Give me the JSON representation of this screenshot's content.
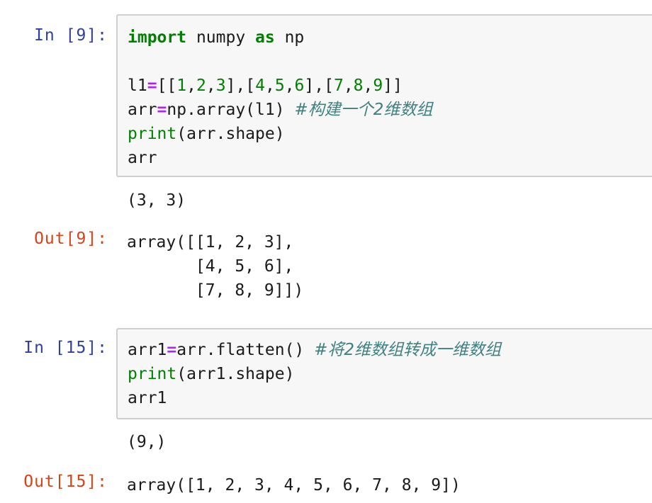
{
  "cells": [
    {
      "in_prompt": "In [9]:",
      "code": {
        "line1": {
          "kw1": "import",
          "mid": " numpy ",
          "kw2": "as",
          "tail": " np"
        },
        "line2": {
          "var": "l1",
          "op": "=",
          "p1": "[[",
          "n1": "1",
          "c1": ",",
          "n2": "2",
          "c2": ",",
          "n3": "3",
          "p2": "],[",
          "n4": "4",
          "c3": ",",
          "n5": "5",
          "c4": ",",
          "n6": "6",
          "p3": "],[",
          "n7": "7",
          "c5": ",",
          "n8": "8",
          "c6": ",",
          "n9": "9",
          "p4": "]]"
        },
        "line3": {
          "var": "arr",
          "op": "=",
          "rest": "np.array(l1) ",
          "comment": "#构建一个2维数组"
        },
        "line4": {
          "fn": "print",
          "rest": "(arr.shape)"
        },
        "line5": {
          "text": "arr"
        }
      },
      "stdout": "(3, 3)",
      "out_prompt": "Out[9]:",
      "result_lines": [
        "array([[1, 2, 3],",
        "       [4, 5, 6],",
        "       [7, 8, 9]])"
      ]
    },
    {
      "in_prompt": "In [15]:",
      "code": {
        "line1": {
          "var": "arr1",
          "op": "=",
          "rest": "arr.flatten() ",
          "comment": "#将2维数组转成一维数组"
        },
        "line2": {
          "fn": "print",
          "rest": "(arr1.shape)"
        },
        "line3": {
          "text": "arr1"
        }
      },
      "stdout": "(9,)",
      "out_prompt": "Out[15]:",
      "result_lines": [
        "array([1, 2, 3, 4, 5, 6, 7, 8, 9])"
      ]
    }
  ]
}
